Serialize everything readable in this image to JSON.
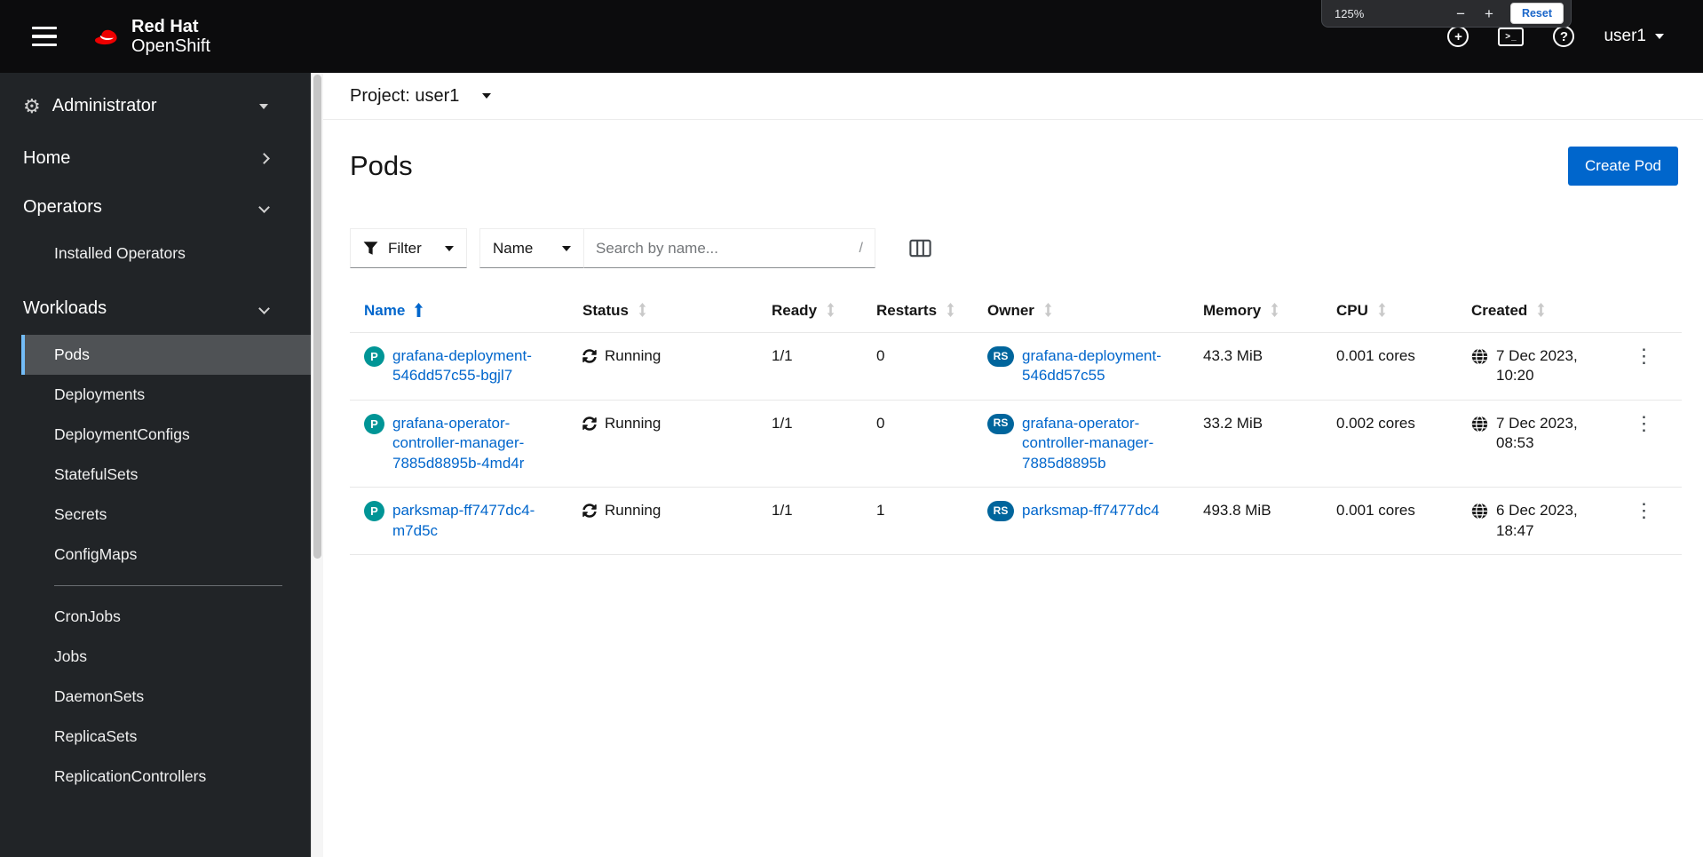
{
  "colors": {
    "accent": "#0066cc",
    "masthead_bg": "#0c0c0d",
    "sidebar_bg": "#212427",
    "selected_nav_bg": "#4f5255",
    "selected_nav_border": "#73bcf7",
    "pod_badge_bg": "#009596",
    "owner_badge_bg": "#00659c"
  },
  "icons": {
    "gear": "⚙",
    "kebab": "⋮",
    "plus_glyph": "+",
    "terminal_glyph": ">_",
    "help_glyph": "?"
  },
  "masthead": {
    "brand_line1": "Red Hat",
    "brand_line2": "OpenShift",
    "user_label": "user1"
  },
  "zoom_popup": {
    "level": "125%",
    "minus_label": "−",
    "plus_label": "+",
    "reset_label": "Reset"
  },
  "sidebar": {
    "perspective_label": "Administrator",
    "sections": [
      {
        "label": "Home",
        "expanded": false
      },
      {
        "label": "Operators",
        "expanded": true,
        "children": [
          {
            "label": "Installed Operators"
          }
        ]
      },
      {
        "label": "Workloads",
        "expanded": true,
        "children": [
          {
            "label": "Pods",
            "active": true
          },
          {
            "label": "Deployments"
          },
          {
            "label": "DeploymentConfigs"
          },
          {
            "label": "StatefulSets"
          },
          {
            "label": "Secrets"
          },
          {
            "label": "ConfigMaps"
          },
          {
            "divider": true
          },
          {
            "label": "CronJobs"
          },
          {
            "label": "Jobs"
          },
          {
            "label": "DaemonSets"
          },
          {
            "label": "ReplicaSets"
          },
          {
            "label": "ReplicationControllers"
          }
        ]
      }
    ]
  },
  "project_bar": {
    "label": "Project: user1"
  },
  "page": {
    "title": "Pods",
    "create_button_label": "Create Pod"
  },
  "toolbar": {
    "filter_label": "Filter",
    "attribute_label": "Name",
    "search_placeholder": "Search by name...",
    "search_shortcut": "/"
  },
  "table": {
    "pod_badge": "P",
    "owner_badge": "RS",
    "columns": [
      {
        "label": "Name",
        "sort": "asc"
      },
      {
        "label": "Status",
        "sortable": true
      },
      {
        "label": "Ready",
        "sortable": true
      },
      {
        "label": "Restarts",
        "sortable": true
      },
      {
        "label": "Owner",
        "sortable": true
      },
      {
        "label": "Memory",
        "sortable": true
      },
      {
        "label": "CPU",
        "sortable": true
      },
      {
        "label": "Created",
        "sortable": true
      }
    ],
    "rows": [
      {
        "name": "grafana-deployment-546dd57c55-bgjl7",
        "status": "Running",
        "ready": "1/1",
        "restarts": "0",
        "owner": "grafana-deployment-546dd57c55",
        "memory": "43.3 MiB",
        "cpu": "0.001 cores",
        "created": "7 Dec 2023, 10:20"
      },
      {
        "name": "grafana-operator-controller-manager-7885d8895b-4md4r",
        "status": "Running",
        "ready": "1/1",
        "restarts": "0",
        "owner": "grafana-operator-controller-manager-7885d8895b",
        "memory": "33.2 MiB",
        "cpu": "0.002 cores",
        "created": "7 Dec 2023, 08:53"
      },
      {
        "name": "parksmap-ff7477dc4-m7d5c",
        "status": "Running",
        "ready": "1/1",
        "restarts": "1",
        "owner": "parksmap-ff7477dc4",
        "memory": "493.8 MiB",
        "cpu": "0.001 cores",
        "created": "6 Dec 2023, 18:47"
      }
    ]
  }
}
